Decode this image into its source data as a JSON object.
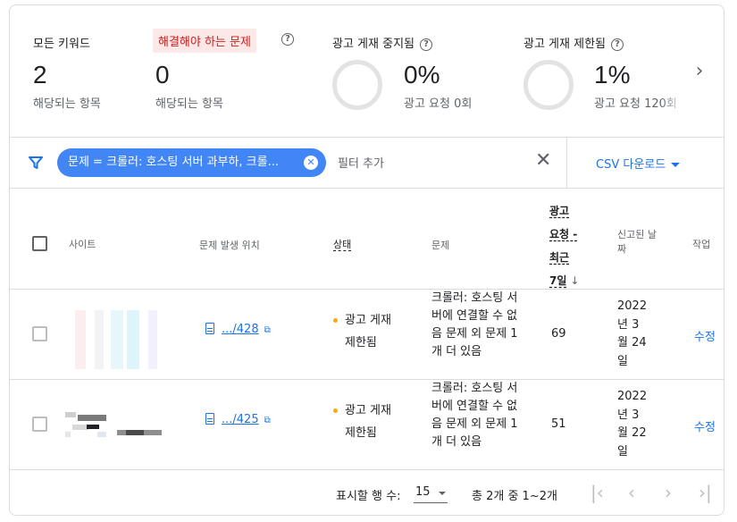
{
  "metrics": [
    {
      "title": "모든 키워드",
      "value": "2",
      "sub": "해당되는 항목"
    },
    {
      "title": "해결해야 하는 문제",
      "value": "0",
      "sub": "해당되는 항목"
    },
    {
      "title": "광고 게재 중지됨",
      "value": "0%",
      "sub": "광고 요청 0회"
    },
    {
      "title": "광고 게재 제한됨",
      "value": "1%",
      "sub": "광고 요청 120회"
    }
  ],
  "filter": {
    "chip_label": "문제 = 크롤러: 호스팅 서버 과부하, 크롤...",
    "add_filter": "필터 추가",
    "csv_label": "CSV 다운로드"
  },
  "table": {
    "headers": {
      "site": "사이트",
      "location": "문제 발생 위치",
      "status": "상태",
      "issue": "문제",
      "ad_requests_lines": [
        "광고",
        "요청 -",
        "최근",
        "7일"
      ],
      "reported_date": "신고된 날짜",
      "action": "작업"
    },
    "rows": [
      {
        "url": ".../428",
        "status": "광고 게재 제한됨",
        "issue": "크롤러: 호스팅 서버에 연결할 수 없음 문제 외 문제 1개 더 있음",
        "ads": "69",
        "date": "2022 년 3 월 24 일",
        "action": "수정"
      },
      {
        "url": ".../425",
        "status": "광고 게재 제한됨",
        "issue": "크롤러: 호스팅 서버에 연결할 수 없음 문제 외 문제 1개 더 있음",
        "ads": "51",
        "date": "2022 년 3 월 22 일",
        "action": "수정"
      }
    ]
  },
  "footer": {
    "rows_label": "표시할 행 수:",
    "rows_value": "15",
    "range": "총 2개 중 1~2개"
  },
  "icons": [
    "help-icon",
    "chevron-right-icon",
    "filter-icon",
    "close-icon",
    "caret-down-icon",
    "document-icon",
    "open-in-new-icon",
    "arrow-down-icon",
    "first-page-icon",
    "prev-page-icon",
    "next-page-icon",
    "last-page-icon"
  ],
  "colors": {
    "accent": "#1a73e8",
    "chip": "#4285f4",
    "error_bg": "#fce8e6",
    "error_text": "#c5221f",
    "status_dot": "#f9ab00"
  }
}
